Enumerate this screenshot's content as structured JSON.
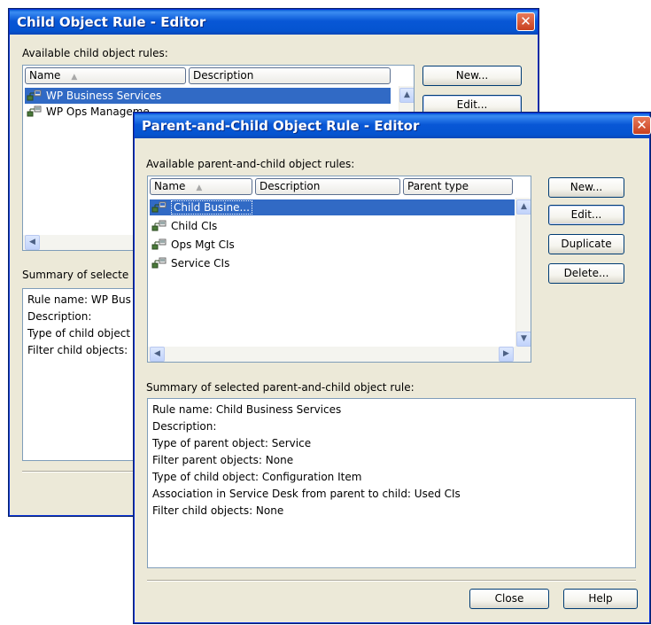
{
  "child_window": {
    "title": "Child Object Rule - Editor",
    "close_glyph": "✕",
    "available_label": "Available child object rules:",
    "columns": [
      "Name",
      "Description"
    ],
    "sort_glyph": "▲",
    "rows": [
      {
        "name": "WP Business Services",
        "selected": true
      },
      {
        "name": "WP Ops Manageme",
        "selected": false
      }
    ],
    "buttons": {
      "new": "New...",
      "edit": "Edit..."
    },
    "summary_label": "Summary of selecte",
    "summary_lines": [
      "Rule name:  WP Bus",
      "Description:",
      "Type of child object",
      "Filter child objects:"
    ]
  },
  "parent_child_window": {
    "title": "Parent-and-Child Object Rule - Editor",
    "close_glyph": "✕",
    "available_label": "Available parent-and-child object rules:",
    "columns": [
      "Name",
      "Description",
      "Parent type"
    ],
    "sort_glyph": "▲",
    "rows": [
      {
        "name": "Child Busine...",
        "selected": true
      },
      {
        "name": "Child CIs",
        "selected": false
      },
      {
        "name": "Ops Mgt CIs",
        "selected": false
      },
      {
        "name": "Service CIs",
        "selected": false
      }
    ],
    "buttons": {
      "new": "New...",
      "edit": "Edit...",
      "duplicate": "Duplicate",
      "delete": "Delete..."
    },
    "summary_label": "Summary of selected parent-and-child object rule:",
    "summary_lines": [
      "Rule name:  Child Business Services",
      "Description:",
      "Type of parent object: Service",
      "Filter parent objects:  None",
      "Type of child object:  Configuration Item",
      "Association in Service Desk from parent to child: Used CIs",
      "Filter child objects:  None"
    ],
    "footer_buttons": {
      "close": "Close",
      "help": "Help"
    }
  },
  "scroll_glyphs": {
    "up": "▲",
    "down": "▼",
    "left": "◀",
    "right": "▶"
  },
  "colors": {
    "titlebar": "#0857d6",
    "selection": "#316ac5",
    "dialog_bg": "#ece9d8"
  }
}
